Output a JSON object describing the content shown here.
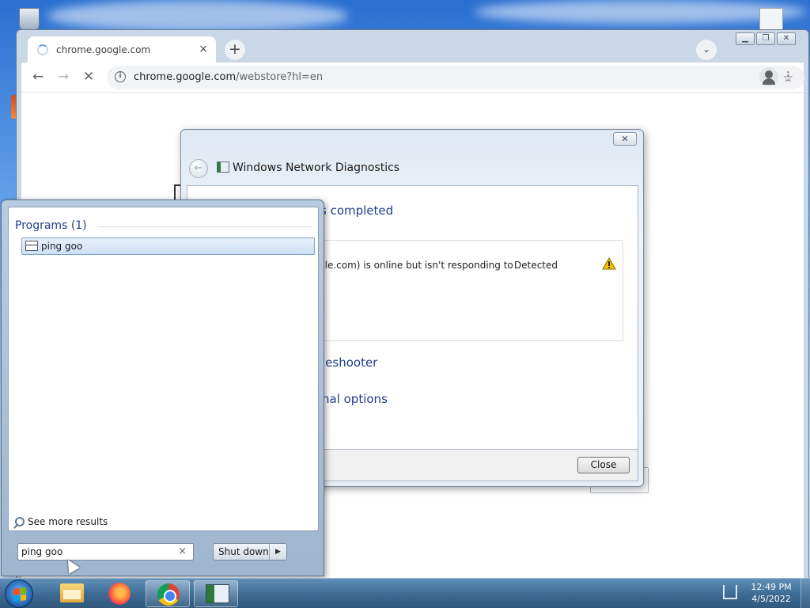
{
  "browser": {
    "tab_title": "chrome.google.com",
    "tab_close_glyph": "×",
    "new_tab_glyph": "+",
    "tab_search_glyph": "⌄",
    "url_host": "chrome.google.com",
    "url_path": "/webstore?hl=en",
    "icons": [
      "back-icon",
      "forward-icon",
      "stop-loading-icon",
      "site-info-icon",
      "share-icon",
      "bookmark-star-icon",
      "profile-icon",
      "menu-icon"
    ]
  },
  "diagnostics": {
    "title": "Windows Network Diagnostics",
    "heading_visible": "s completed",
    "problem_text_visible": "gle.com) is online but isn't responding to",
    "problem_status": "Detected",
    "link_1_visible": "leshooter",
    "link_2_visible": "nal options",
    "close_button": "Close",
    "close_glyph": "✕"
  },
  "start_menu": {
    "programs_header": "Programs (1)",
    "program_item": "ping goo",
    "see_more": "See more results",
    "search_value": "ping goo",
    "search_clear_glyph": "×",
    "shutdown_label": "Shut down",
    "shutdown_arrow_glyph": "▶"
  },
  "taskbar": {
    "items": [
      "windows-explorer",
      "firefox",
      "chrome",
      "network-diagnostics"
    ],
    "time": "12:49 PM",
    "date": "4/5/2022"
  },
  "colors": {
    "link_blue": "#1e3e8a",
    "taskbar": "#3c6a93",
    "warning": "#f2c200"
  }
}
